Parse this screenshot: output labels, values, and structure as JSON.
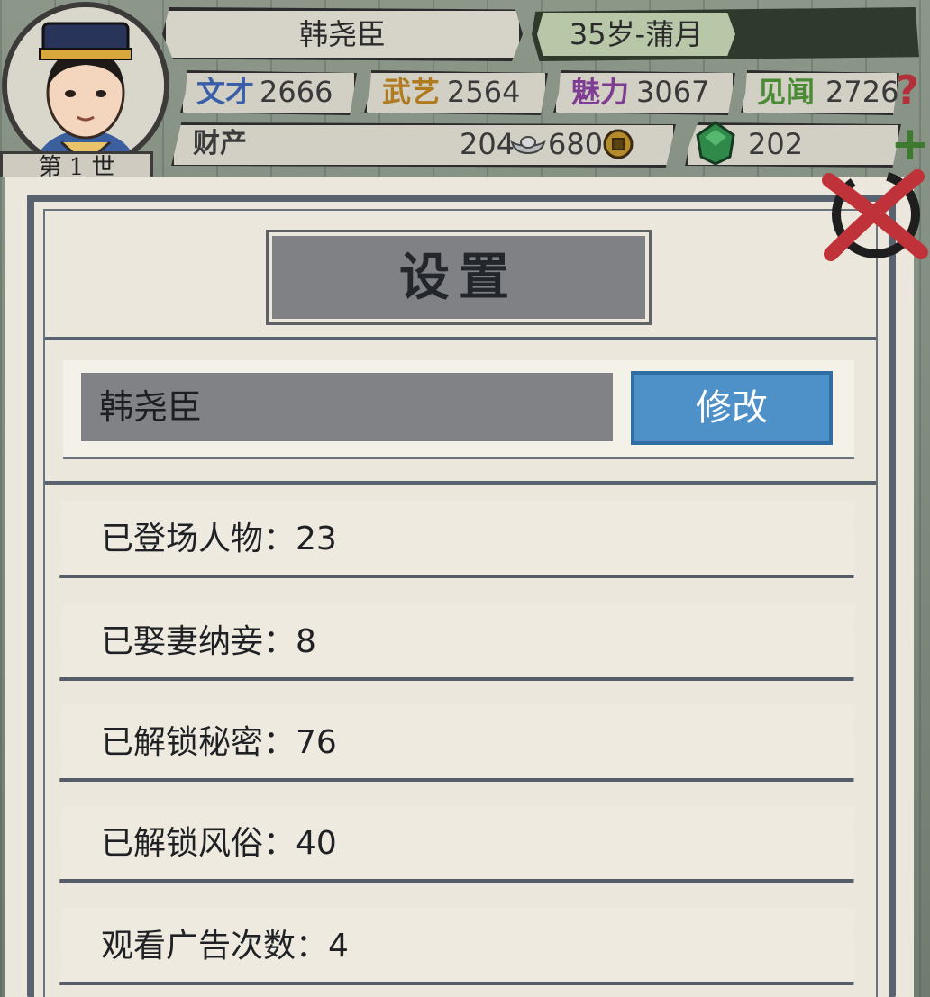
{
  "header": {
    "name": "韩尧臣",
    "age": "35岁-蒲月",
    "generation": "第 1 世"
  },
  "stats": [
    {
      "label": "文才",
      "value": "2666",
      "color": "#3a5fa8"
    },
    {
      "label": "武艺",
      "value": "2564",
      "color": "#b07a1e"
    },
    {
      "label": "魅力",
      "value": "3067",
      "color": "#7e3c92"
    },
    {
      "label": "见闻",
      "value": "2726",
      "color": "#4a8a35"
    }
  ],
  "wealth": {
    "label": "财产",
    "silver": "204",
    "coins": "680",
    "jade": "202"
  },
  "settings": {
    "title": "设置",
    "name_value": "韩尧臣",
    "modify_label": "修改",
    "rows": [
      "已登场人物：23",
      "已娶妻纳妾：8",
      "已解锁秘密：76",
      "已解锁风俗：40",
      "观看广告次数：4"
    ]
  },
  "icons": {
    "help": "question-mark-icon",
    "close": "close-icon",
    "add": "plus-icon"
  },
  "colors": {
    "accent_button": "#4e90c8",
    "panel_frame": "#59636f",
    "close_red": "#c0323a"
  }
}
